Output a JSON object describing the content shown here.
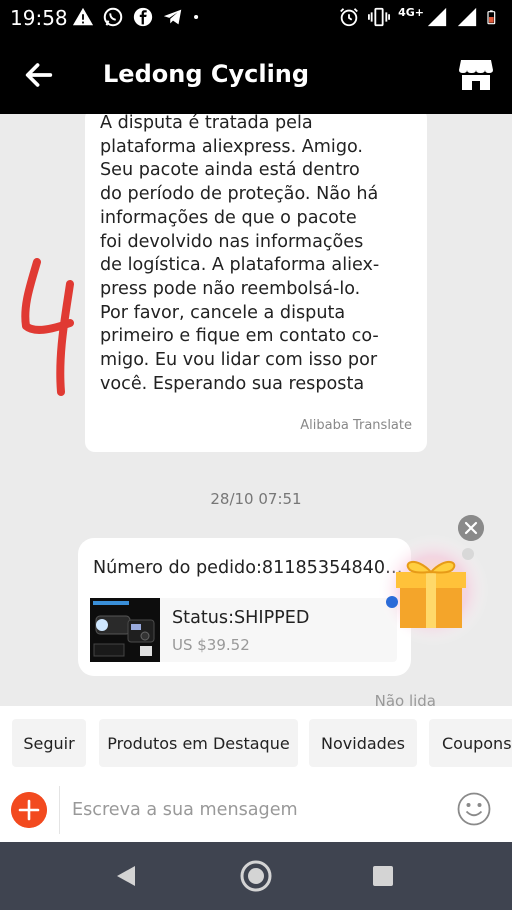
{
  "status_bar": {
    "time": "19:58",
    "network": "4G+",
    "left_icons": [
      "alert-icon",
      "whatsapp-icon",
      "facebook-icon",
      "telegram-icon",
      "dot-icon"
    ],
    "right_icons": [
      "alarm-icon",
      "vibrate-icon",
      "signal-icon",
      "signal-icon",
      "battery-low-icon"
    ],
    "battery_color": "#e05a3a"
  },
  "header": {
    "title": "Ledong Cycling",
    "back_icon": "arrow-left-icon",
    "store_icon": "store-icon"
  },
  "message": {
    "lines": [
      "A disputa é tratada pela",
      "plataforma aliexpress. Amigo.",
      "Seu pacote ainda está dentro",
      "do período de proteção. Não há",
      "informações de que o pacote",
      "foi devolvido nas informações",
      "de logística. A plataforma aliex-",
      "press pode não reembolsá-lo.",
      "Por favor, cancele a disputa",
      "primeiro e fique em contato co-",
      "migo. Eu vou lidar com isso por",
      "você. Esperando sua resposta"
    ],
    "translation_credit": "Alibaba Translate"
  },
  "timestamp": "28/10 07:51",
  "order_card": {
    "order_number": "Número do pedido:811853548402...",
    "status": "Status:SHIPPED",
    "price": "US $39.52"
  },
  "unread_label": "Não lida",
  "quick_replies": [
    "Seguir",
    "Produtos em Destaque",
    "Novidades",
    "Coupons"
  ],
  "composer": {
    "placeholder": "Escreva a sua mensagem",
    "value": ""
  },
  "colors": {
    "accent": "#f24a1f",
    "annotation": "#e03a33",
    "nav_bar": "#3f4450"
  }
}
